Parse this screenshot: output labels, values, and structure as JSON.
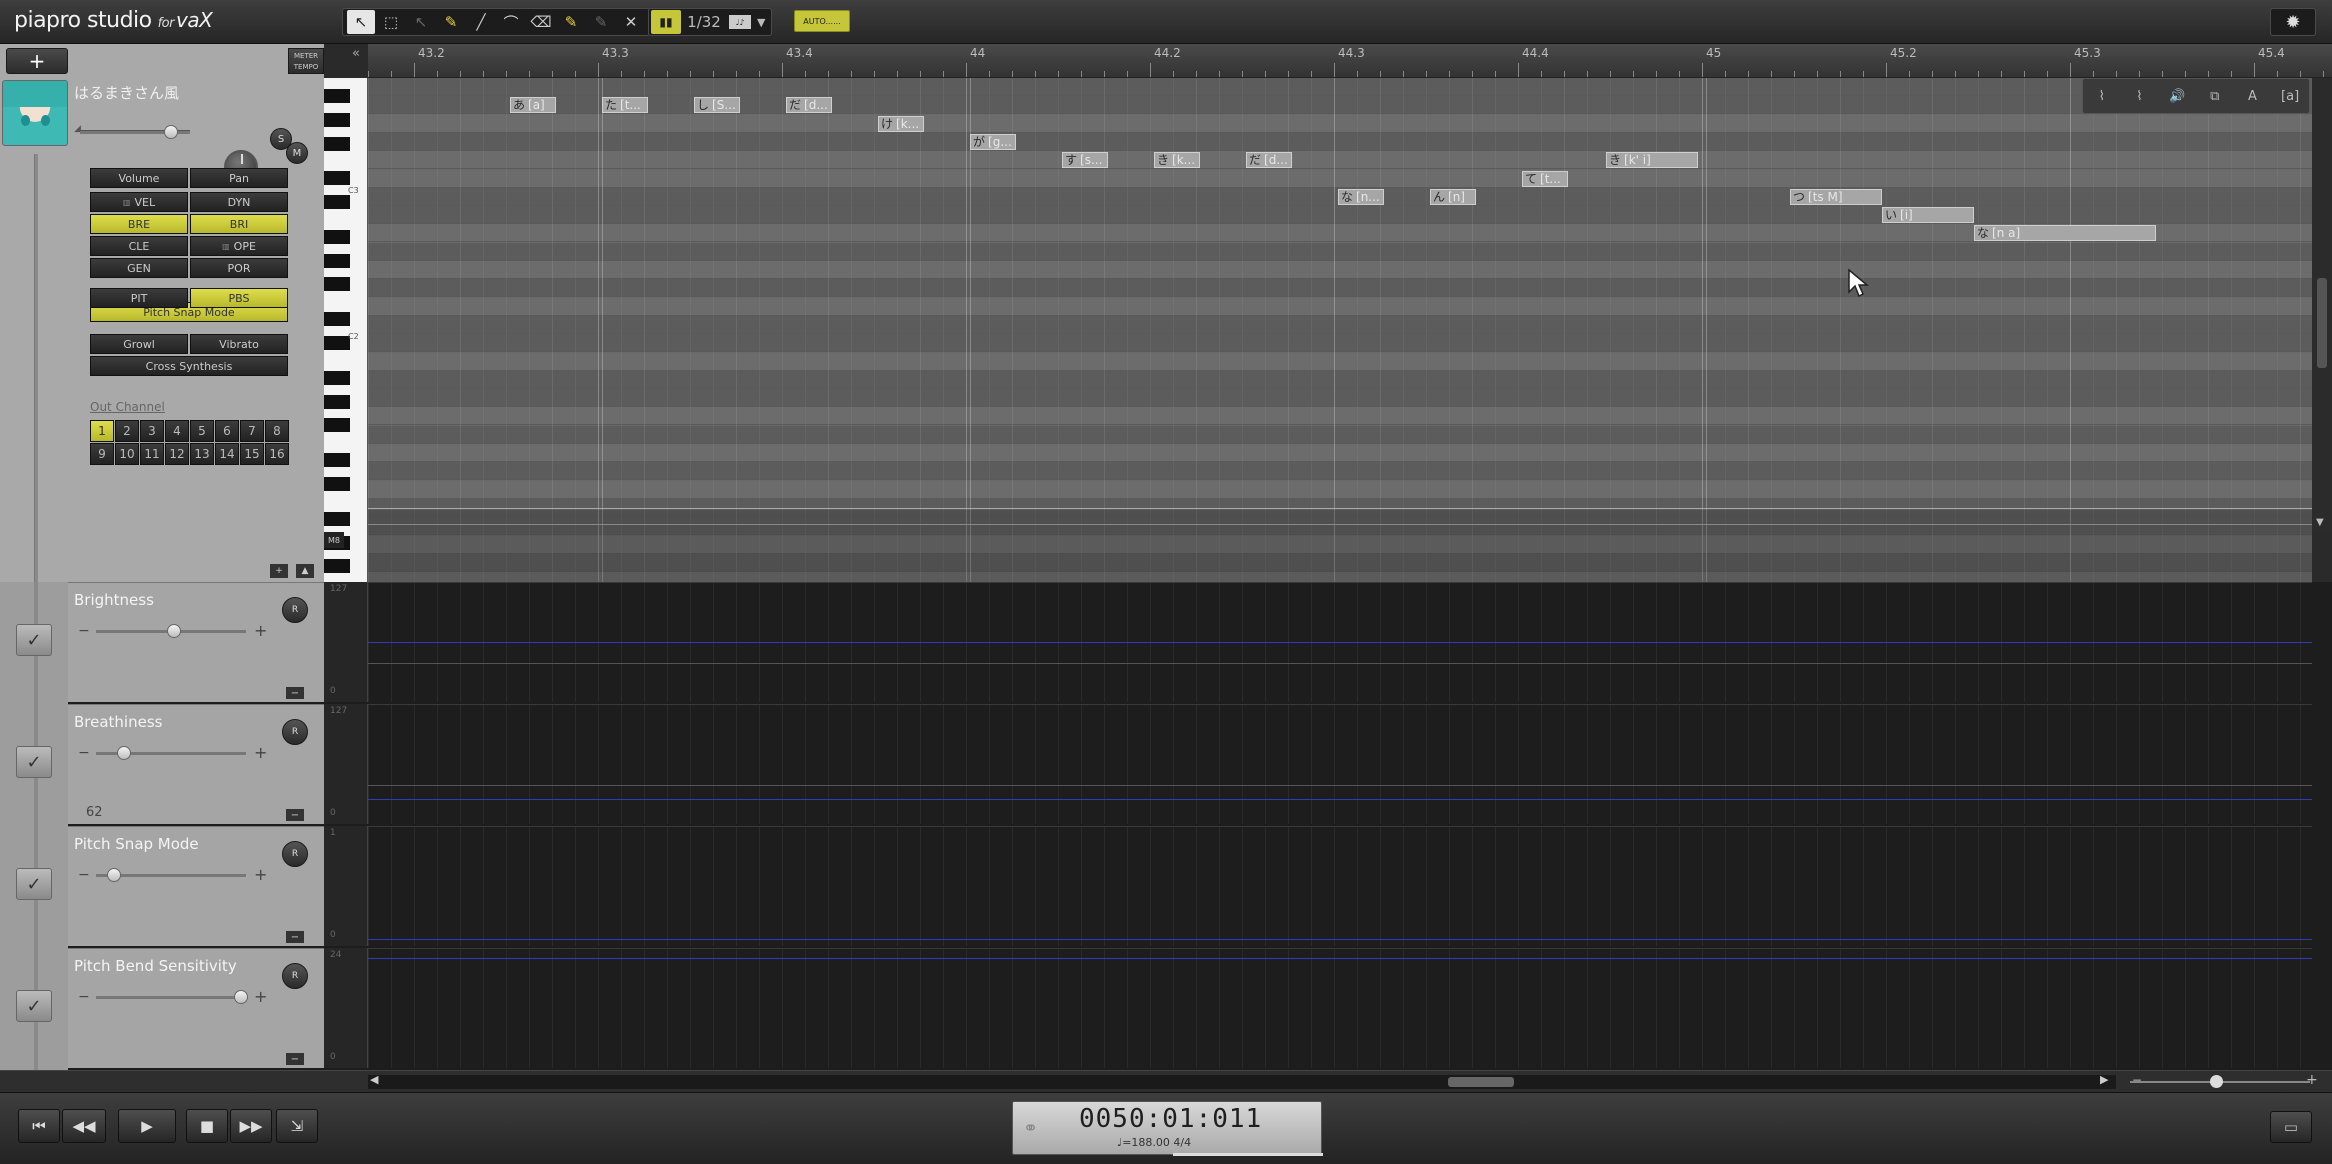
{
  "app": {
    "logo_main": "piapro studio",
    "logo_for": "for",
    "logo_vx": "vaX"
  },
  "toolbar": {
    "tools": [
      {
        "name": "select-tool",
        "glyph": "↖",
        "active": true
      },
      {
        "name": "range-select-tool",
        "glyph": "⬚",
        "active": false
      },
      {
        "name": "grab-tool",
        "glyph": "↖",
        "active": false,
        "dim": true
      },
      {
        "name": "pencil-tool",
        "glyph": "✎",
        "active": false,
        "yellow": true
      },
      {
        "name": "line-tool",
        "glyph": "╱",
        "active": false
      },
      {
        "name": "curve-tool",
        "glyph": "⌒",
        "active": false
      },
      {
        "name": "eraser-tool",
        "glyph": "⌫",
        "active": false
      },
      {
        "name": "brush-tool",
        "glyph": "✎",
        "active": false,
        "yellow": true
      },
      {
        "name": "pen-tool",
        "glyph": "✎",
        "active": false,
        "dim": true
      },
      {
        "name": "close-tool",
        "glyph": "✕",
        "active": false
      }
    ],
    "quantize_value": "1/32",
    "quantize_badge": "♩♪",
    "auto_label": "AUTO......"
  },
  "track": {
    "add_label": "+",
    "meter_tempo_label": "METER TEMPO",
    "voice_name": "はるまきさん風",
    "solo_label": "S",
    "mute_label": "M",
    "param_rows": [
      {
        "left": "Volume",
        "right": "Pan",
        "left_on": false,
        "right_on": false
      },
      {
        "left": "VEL",
        "right": "DYN",
        "left_on": false,
        "right_on": false,
        "left_icon": true
      },
      {
        "left": "BRE",
        "right": "BRI",
        "left_on": true,
        "right_on": true
      },
      {
        "left": "CLE",
        "right": "OPE",
        "left_on": false,
        "right_on": false,
        "right_icon": true
      },
      {
        "left": "GEN",
        "right": "POR",
        "left_on": false,
        "right_on": false
      },
      {
        "left": "PIT",
        "right": "PBS",
        "left_on": false,
        "right_on": true
      }
    ],
    "pitch_snap_label": "Pitch Snap Mode",
    "growl_label": "Growl",
    "vibrato_label": "Vibrato",
    "cross_synth_label": "Cross Synthesis",
    "out_channel_label": "Out Channel",
    "channels": [
      "1",
      "2",
      "3",
      "4",
      "5",
      "6",
      "7",
      "8",
      "9",
      "10",
      "11",
      "12",
      "13",
      "14",
      "15",
      "16"
    ],
    "active_channel": "1"
  },
  "keyboard": {
    "c3_label": "C3",
    "c2_label": "C2",
    "tag_label": "M8"
  },
  "ruler": {
    "labels": [
      "43.2",
      "43.3",
      "43.4",
      "44",
      "44.2",
      "44.3",
      "44.4",
      "45",
      "45.2",
      "45.3",
      "45.4"
    ]
  },
  "notes": [
    {
      "lyric": "あ",
      "phoneme": "[a]"
    },
    {
      "lyric": "た",
      "phoneme": "[t..."
    },
    {
      "lyric": "し",
      "phoneme": "[S..."
    },
    {
      "lyric": "だ",
      "phoneme": "[d..."
    },
    {
      "lyric": "け",
      "phoneme": "[k..."
    },
    {
      "lyric": "が",
      "phoneme": "[g..."
    },
    {
      "lyric": "す",
      "phoneme": "[s..."
    },
    {
      "lyric": "き",
      "phoneme": "[k..."
    },
    {
      "lyric": "だ",
      "phoneme": "[d..."
    },
    {
      "lyric": "な",
      "phoneme": "[n..."
    },
    {
      "lyric": "ん",
      "phoneme": "[n]"
    },
    {
      "lyric": "て",
      "phoneme": "[t..."
    },
    {
      "lyric": "き",
      "phoneme": "[k' i]"
    },
    {
      "lyric": "つ",
      "phoneme": "[ts M]"
    },
    {
      "lyric": "い",
      "phoneme": "[i]"
    },
    {
      "lyric": "な",
      "phoneme": "[n a]"
    }
  ],
  "lanes": [
    {
      "title": "Brightness",
      "value": "",
      "knob_fraction": 0.5,
      "axis_top": "127",
      "axis_bottom": "0",
      "line_fraction": 0.5,
      "line_color": "blue"
    },
    {
      "title": "Breathiness",
      "value": "62",
      "knob_fraction": 0.15,
      "axis_top": "127",
      "axis_bottom": "0",
      "line_fraction": 0.2,
      "line_color": "blue"
    },
    {
      "title": "Pitch Snap Mode",
      "value": "",
      "knob_fraction": 0.08,
      "axis_top": "1",
      "axis_bottom": "0",
      "line_fraction": 0.05,
      "line_color": "blue"
    },
    {
      "title": "Pitch Bend Sensitivity",
      "value": "",
      "knob_fraction": 0.97,
      "axis_top": "24",
      "axis_bottom": "0",
      "line_fraction": 0.92,
      "line_color": "blue"
    }
  ],
  "transport": {
    "time": "0050:01:011",
    "tempo_meter": "♩=188.00  4/4"
  },
  "colors": {
    "accent_yellow": "#c6c63a",
    "lane_line": "#2e3cb8",
    "note_fill": "#a6a6a6"
  }
}
